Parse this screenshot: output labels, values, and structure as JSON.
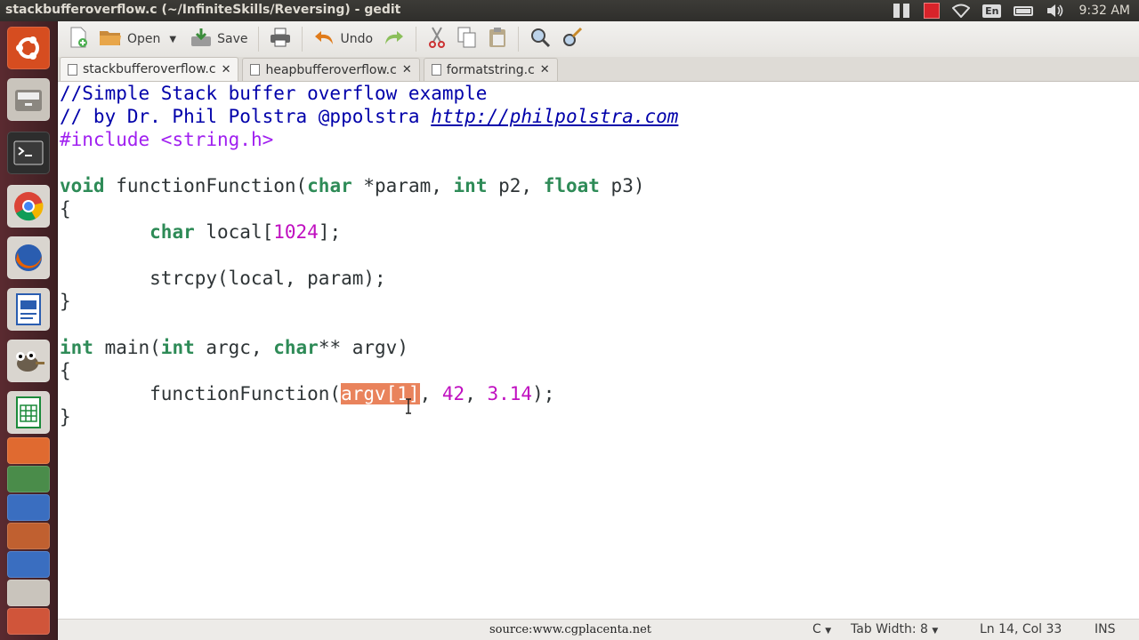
{
  "window": {
    "title": "stackbufferoverflow.c (~/InfiniteSkills/Reversing) - gedit"
  },
  "panel": {
    "keyboard_lang": "En",
    "clock": "9:32 AM"
  },
  "launcher": [
    "ubuntu-dash-icon",
    "files-icon",
    "terminal-icon",
    "chrome-icon",
    "firefox-icon",
    "writer-icon",
    "gimp-icon",
    "calc-icon"
  ],
  "toolbar": {
    "open_label": "Open",
    "save_label": "Save",
    "undo_label": "Undo"
  },
  "tabs": [
    {
      "label": "stackbufferoverflow.c",
      "active": true
    },
    {
      "label": "heapbufferoverflow.c",
      "active": false
    },
    {
      "label": "formatstring.c",
      "active": false
    }
  ],
  "code": {
    "l1": "//Simple Stack buffer overflow example",
    "l2_prefix": "// by Dr. Phil Polstra @ppolstra ",
    "l2_link": "http://philpolstra.com",
    "l3_pre": "#include ",
    "l3_header": "<string.h>",
    "l5_void": "void",
    "l5_a": " functionFunction(",
    "l5_char": "char",
    "l5_b": " *param, ",
    "l5_int": "int",
    "l5_c": " p2, ",
    "l5_float": "float",
    "l5_d": " p3)",
    "l6": "{",
    "l7_indent": "        ",
    "l7_char": "char",
    "l7_a": " local[",
    "l7_num": "1024",
    "l7_b": "];",
    "l9": "        strcpy(local, param);",
    "l10": "}",
    "l12_int": "int",
    "l12_a": " main(",
    "l12_int2": "int",
    "l12_b": " argc, ",
    "l12_char": "char",
    "l12_c": "** argv)",
    "l13": "{",
    "l14_a": "        functionFunction(",
    "l14_sel": "argv[1]",
    "l14_b": ", ",
    "l14_n1": "42",
    "l14_c": ", ",
    "l14_n2": "3.14",
    "l14_d": ");",
    "l15": "}"
  },
  "status": {
    "watermark": "source:www.cgplacenta.net",
    "language": "C",
    "tab_width": "Tab Width: 8",
    "position": "Ln 14, Col 33",
    "mode": "INS"
  }
}
